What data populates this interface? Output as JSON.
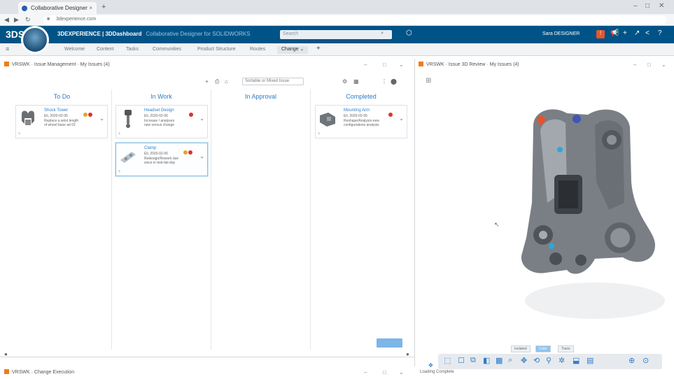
{
  "browser": {
    "tab_title": "Collaborative Designer",
    "tab_close": "×",
    "new_tab": "+",
    "back": "◀",
    "forward": "▶",
    "reload": "↻",
    "lock": "■",
    "url": "3dexperience.com",
    "minimize": "–",
    "maximize": "□",
    "close": "✕"
  },
  "header": {
    "logo": "3DS",
    "brand_bold": "3DEXPERIENCE | 3DDashboard",
    "brand_sub": "Collaborative Designer for SOLIDWORKS",
    "search_placeholder": "Search",
    "search_icon": "⌕",
    "tags_icon": "⬡",
    "user": "Sara DESIGNER",
    "icons": [
      "📢",
      "+",
      "↗",
      "<",
      "?"
    ]
  },
  "dashboard_tabs": {
    "menu_icon": "≡",
    "tabs": [
      "Welcome",
      "Content",
      "Tasks",
      "Communities",
      "Product Structure",
      "Routes",
      "Change"
    ],
    "active": "Change ⌄",
    "plus": "+"
  },
  "left_panel": {
    "title": "VRSWK · Issue Management · My Issues (4)",
    "controls": [
      "–",
      "□",
      "⌄"
    ]
  },
  "board": {
    "filter_placeholder": "Sortable or Mixed Issue",
    "columns": [
      {
        "label": "To Do"
      },
      {
        "label": "In Work"
      },
      {
        "label": "In Approval"
      },
      {
        "label": "Completed"
      }
    ],
    "cards": [
      {
        "title": "Shock Tower",
        "line1": "Eli, 2020-02-06",
        "line2": "Replace a wrist length",
        "line3": "of wheel base ad 02",
        "foot": "+"
      },
      {
        "title": "Headset Design",
        "line1": "Eli, 2020-02-06",
        "line2": "Increase / analyses",
        "line3": "new versus change",
        "foot": "+"
      },
      {
        "title": "Clamp",
        "line1": "Eli, 2020-02-06",
        "line2": "Redesign/Rework due",
        "line3": "since in test-fail-day",
        "foot": "+"
      },
      {
        "title": "Mounting Arm",
        "line1": "Eli, 2020-02-06",
        "line2": "Reshape/Analysis-new",
        "line3": "configurations analysis",
        "foot": "+"
      }
    ],
    "card_more": "⌄",
    "toolbar": [
      "+",
      "⎙",
      "⌂",
      "⚙",
      "▦",
      "⋮",
      "⬤"
    ]
  },
  "right_panel": {
    "title": "VRSWK · Issue 3D Review · My Issues (4)",
    "controls": [
      "–",
      "□",
      "⌄"
    ],
    "view_modes": [
      "Isolated",
      "Color",
      "Trans"
    ],
    "active_mode": "Color",
    "loading_text": "Loading Complete",
    "tools": [
      "⬚",
      "☐",
      "⧉",
      "◧",
      "▩",
      "⌕",
      "✥",
      "⟲",
      "⚲",
      "✲",
      "⬓",
      "▤",
      "⊕",
      "⊙"
    ]
  },
  "bottom_panel": {
    "title": "VRSWK · Change Execution",
    "controls": [
      "–",
      "□",
      "⌄"
    ]
  }
}
